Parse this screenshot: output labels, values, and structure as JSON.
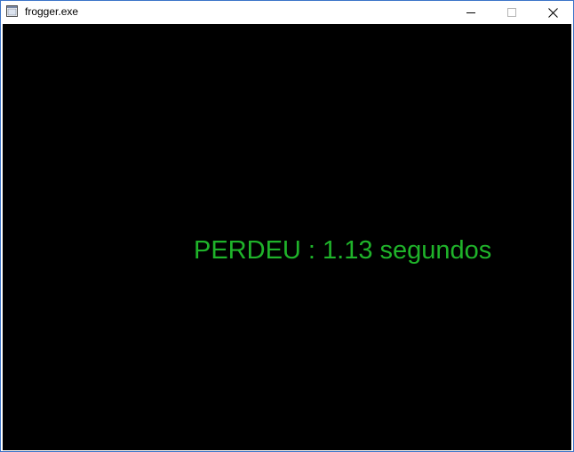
{
  "window": {
    "title": "frogger.exe",
    "icon": "app-window-icon",
    "controls": {
      "minimize": "minimize-icon",
      "maximize": "maximize-icon",
      "close": "close-icon"
    }
  },
  "game": {
    "message": "PERDEU : 1.13 segundos",
    "message_color": "#1fb32a",
    "background_color": "#000000"
  }
}
